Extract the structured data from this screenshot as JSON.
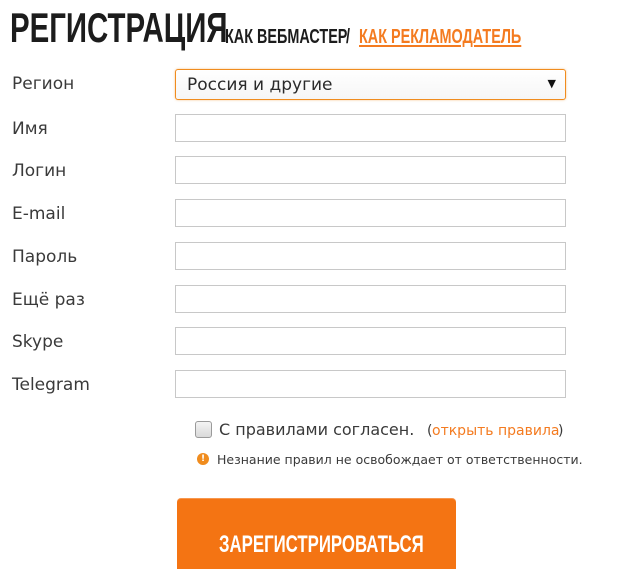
{
  "header": {
    "title": "РЕГИСТРАЦИЯ",
    "webmaster": "КАК ВЕБМАСТЕР",
    "separator": "/",
    "advertiser": "КАК РЕКЛАМОДАТЕЛЬ"
  },
  "form": {
    "region": {
      "label": "Регион",
      "value": "Россия и другие",
      "arrow": "▼"
    },
    "name": {
      "label": "Имя",
      "value": ""
    },
    "login": {
      "label": "Логин",
      "value": ""
    },
    "email": {
      "label": "E-mail",
      "value": ""
    },
    "password": {
      "label": "Пароль",
      "value": ""
    },
    "password_repeat": {
      "label": "Ещё раз",
      "value": ""
    },
    "skype": {
      "label": "Skype",
      "value": ""
    },
    "telegram": {
      "label": "Telegram",
      "value": ""
    }
  },
  "agreement": {
    "label": "С правилами согласен.",
    "paren_open": "(",
    "link": "открыть правила",
    "paren_close": ")",
    "checked": false
  },
  "warning": {
    "icon": "exclamation-circle-icon",
    "text": "Незнание правил не освобождает от ответственности."
  },
  "submit": {
    "label": "ЗАРЕГИСТРИРОВАТЬСЯ"
  },
  "colors": {
    "accent": "#f47b20",
    "button": "#f47413",
    "text": "#3a3a3a"
  }
}
